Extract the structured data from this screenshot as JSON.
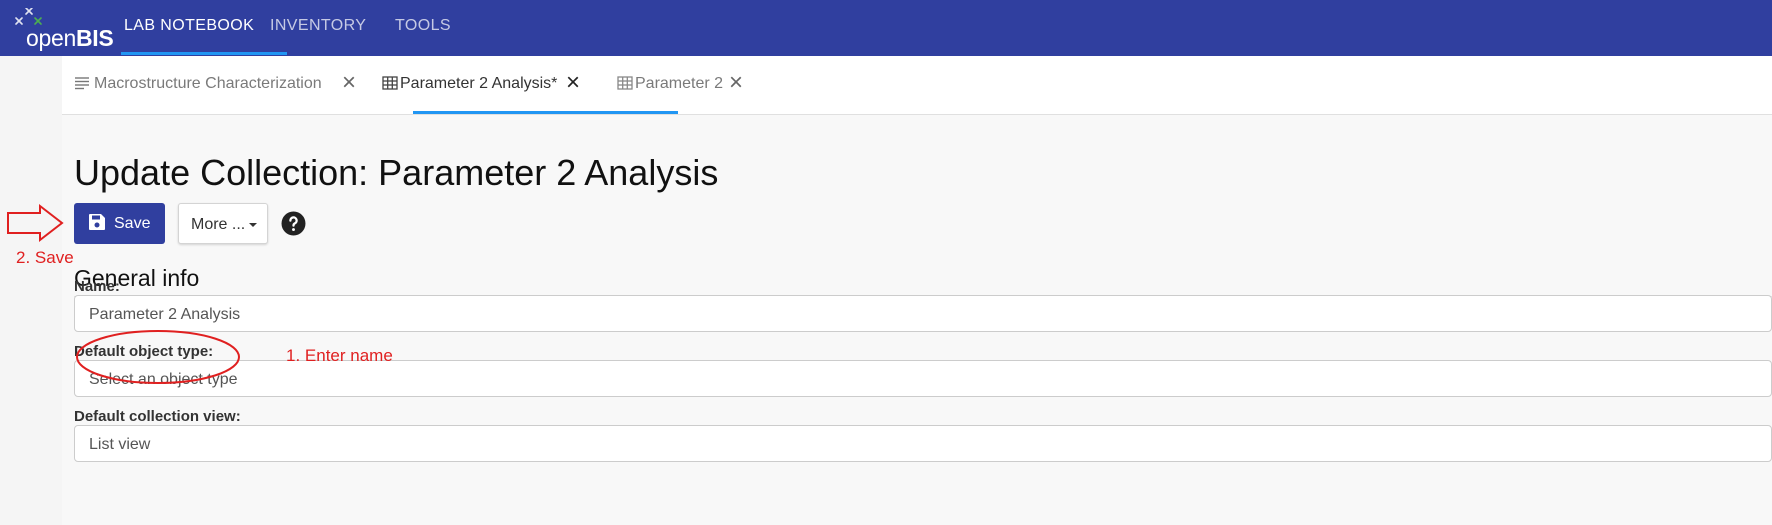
{
  "navbar": {
    "logo": {
      "light": "open",
      "bold": "BIS"
    },
    "items": [
      {
        "label": "LAB NOTEBOOK",
        "active": true
      },
      {
        "label": "INVENTORY",
        "active": false
      },
      {
        "label": "TOOLS",
        "active": false
      }
    ]
  },
  "tabs": [
    {
      "label": "Macrostructure Characterization",
      "icon": "list-icon",
      "active": false
    },
    {
      "label": "Parameter 2 Analysis*",
      "icon": "table-icon",
      "active": true
    },
    {
      "label": "Parameter 2",
      "icon": "table-icon",
      "active": false
    }
  ],
  "page": {
    "title": "Update Collection: Parameter 2 Analysis"
  },
  "toolbar": {
    "save_label": "Save",
    "more_label": "More ...",
    "help_icon": "help-circle-icon"
  },
  "section": {
    "title": "General info"
  },
  "fields": {
    "name": {
      "label": "Name:",
      "value": "Parameter 2 Analysis"
    },
    "default_object_type": {
      "label": "Default object type:",
      "placeholder": "Select an object type"
    },
    "default_collection_view": {
      "label": "Default collection view:",
      "value": "List view"
    }
  },
  "annotations": {
    "step1": "1. Enter name",
    "step2": "2. Save"
  },
  "colors": {
    "navbar": "#303f9f",
    "accent": "#2196f3",
    "primary_button": "#303f9f",
    "annotation": "#e02020"
  }
}
